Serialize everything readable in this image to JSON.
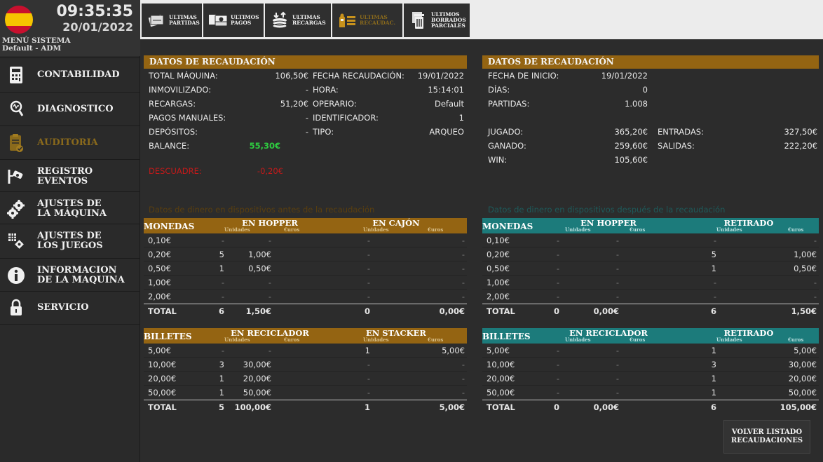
{
  "header": {
    "time": "09:35:35",
    "date": "20/01/2022",
    "menu_title": "MENÚ SISTEMA",
    "user": "Default - ADM"
  },
  "sidebar": {
    "items": [
      {
        "label1": "CONTABILIDAD",
        "label2": "",
        "icon": "calculator-icon",
        "enabled": true
      },
      {
        "label1": "DIAGNOSTICO",
        "label2": "",
        "icon": "stethoscope-icon",
        "enabled": true
      },
      {
        "label1": "AUDITORIA",
        "label2": "",
        "icon": "clipboard-check-icon",
        "enabled": false
      },
      {
        "label1": "REGISTRO",
        "label2": "EVENTOS",
        "icon": "camera-log-icon",
        "enabled": true
      },
      {
        "label1": "AJUSTES DE",
        "label2": "LA MÁQUINA",
        "icon": "gears-icon",
        "enabled": true
      },
      {
        "label1": "AJUSTES DE",
        "label2": "LOS JUEGOS",
        "icon": "game-settings-icon",
        "enabled": true
      },
      {
        "label1": "INFORMACION",
        "label2": "DE LA MAQUINA",
        "icon": "info-icon",
        "enabled": true
      },
      {
        "label1": "SERVICIO",
        "label2": "",
        "icon": "lock-icon",
        "enabled": true
      }
    ]
  },
  "toolbar": {
    "items": [
      {
        "l1": "ULTIMAS",
        "l2": "PARTIDAS",
        "l3": "",
        "icon": "cards-icon"
      },
      {
        "l1": "ULTIMOS",
        "l2": "PAGOS",
        "l3": "",
        "icon": "cash-icon"
      },
      {
        "l1": "ULTIMAS",
        "l2": "RECARGAS",
        "l3": "",
        "icon": "coins-recharge-icon"
      },
      {
        "l1": "ULTIMAS",
        "l2": "RECAUDAC.",
        "l3": "",
        "icon": "collection-icon"
      },
      {
        "l1": "ULTIMOS",
        "l2": "BORRADOS",
        "l3": "PARCIALES",
        "icon": "trash-icon"
      }
    ]
  },
  "left_panel": {
    "title": "DATOS DE RECAUDACIÓN",
    "rows": [
      {
        "label": "TOTAL MÁQUINA:",
        "value": "106,50€",
        "label2": "FECHA RECAUDACIÓN:",
        "value2": "19/01/2022"
      },
      {
        "label": "INMOVILIZADO:",
        "value": "-",
        "label2": "HORA:",
        "value2": "15:14:01"
      },
      {
        "label": "RECARGAS:",
        "value": "51,20€",
        "label2": "OPERARIO:",
        "value2": "Default"
      },
      {
        "label": "PAGOS MANUALES:",
        "value": "-",
        "label2": "IDENTIFICADOR:",
        "value2": "1"
      },
      {
        "label": "DEPÓSITOS:",
        "value": "-",
        "label2": "TIPO:",
        "value2": "ARQUEO"
      },
      {
        "label": "BALANCE:",
        "value": "55,30€",
        "label2": "",
        "value2": ""
      }
    ],
    "descuadre_label": "DESCUADRE:",
    "descuadre_value": "-0,20€"
  },
  "right_panel": {
    "title": "DATOS DE RECAUDACIÓN",
    "fecha_label": "FECHA DE INICIO:",
    "fecha_value": "19/01/2022",
    "dias_label": "DÍAS:",
    "dias_value": "0",
    "partidas_label": "PARTIDAS:",
    "partidas_value": "1.008",
    "jugado_label": "JUGADO:",
    "jugado_value": "365,20€",
    "ganado_label": "GANADO:",
    "ganado_value": "259,60€",
    "win_label": "WIN:",
    "win_value": "105,60€",
    "entradas_label": "ENTRADAS:",
    "entradas_value": "327,50€",
    "salidas_label": "SALIDAS:",
    "salidas_value": "222,20€"
  },
  "before": {
    "section_title": "Datos de dinero en dispositivos antes de la recaudación",
    "coins": {
      "header": "MONEDAS",
      "g1": "EN HOPPER",
      "g2": "EN CAJÓN",
      "units": "Unidades",
      "euros": "€uros",
      "rows": [
        [
          "0,10€",
          "-",
          "-",
          "-",
          "-"
        ],
        [
          "0,20€",
          "5",
          "1,00€",
          "-",
          "-"
        ],
        [
          "0,50€",
          "1",
          "0,50€",
          "-",
          "-"
        ],
        [
          "1,00€",
          "-",
          "-",
          "-",
          "-"
        ],
        [
          "2,00€",
          "-",
          "-",
          "-",
          "-"
        ]
      ],
      "total": [
        "TOTAL",
        "6",
        "1,50€",
        "0",
        "0,00€"
      ]
    },
    "bills": {
      "header": "BILLETES",
      "g1": "EN RECICLADOR",
      "g2": "EN STACKER",
      "units": "Unidades",
      "euros": "€uros",
      "rows": [
        [
          "5,00€",
          "-",
          "-",
          "1",
          "5,00€"
        ],
        [
          "10,00€",
          "3",
          "30,00€",
          "-",
          "-"
        ],
        [
          "20,00€",
          "1",
          "20,00€",
          "-",
          "-"
        ],
        [
          "50,00€",
          "1",
          "50,00€",
          "-",
          "-"
        ]
      ],
      "total": [
        "TOTAL",
        "5",
        "100,00€",
        "1",
        "5,00€"
      ]
    }
  },
  "after": {
    "section_title": "Datos de dinero en dispositivos después de la recaudación",
    "coins": {
      "header": "MONEDAS",
      "g1": "EN HOPPER",
      "g2": "RETIRADO",
      "units": "Unidades",
      "euros": "€uros",
      "rows": [
        [
          "0,10€",
          "-",
          "-",
          "-",
          "-"
        ],
        [
          "0,20€",
          "-",
          "-",
          "5",
          "1,00€"
        ],
        [
          "0,50€",
          "-",
          "-",
          "1",
          "0,50€"
        ],
        [
          "1,00€",
          "-",
          "-",
          "-",
          "-"
        ],
        [
          "2,00€",
          "-",
          "-",
          "-",
          "-"
        ]
      ],
      "total": [
        "TOTAL",
        "0",
        "0,00€",
        "6",
        "1,50€"
      ]
    },
    "bills": {
      "header": "BILLETES",
      "g1": "EN RECICLADOR",
      "g2": "RETIRADO",
      "units": "Unidades",
      "euros": "€uros",
      "rows": [
        [
          "5,00€",
          "-",
          "-",
          "1",
          "5,00€"
        ],
        [
          "10,00€",
          "-",
          "-",
          "3",
          "30,00€"
        ],
        [
          "20,00€",
          "-",
          "-",
          "1",
          "20,00€"
        ],
        [
          "50,00€",
          "-",
          "-",
          "1",
          "50,00€"
        ]
      ],
      "total": [
        "TOTAL",
        "0",
        "0,00€",
        "6",
        "105,00€"
      ]
    }
  },
  "back_button": {
    "l1": "VOLVER LISTADO",
    "l2": "RECAUDACIONES"
  },
  "colors": {
    "gold": "#946412",
    "teal": "#1c7b7b",
    "green": "#2ecc40",
    "red": "#c41a1a"
  }
}
